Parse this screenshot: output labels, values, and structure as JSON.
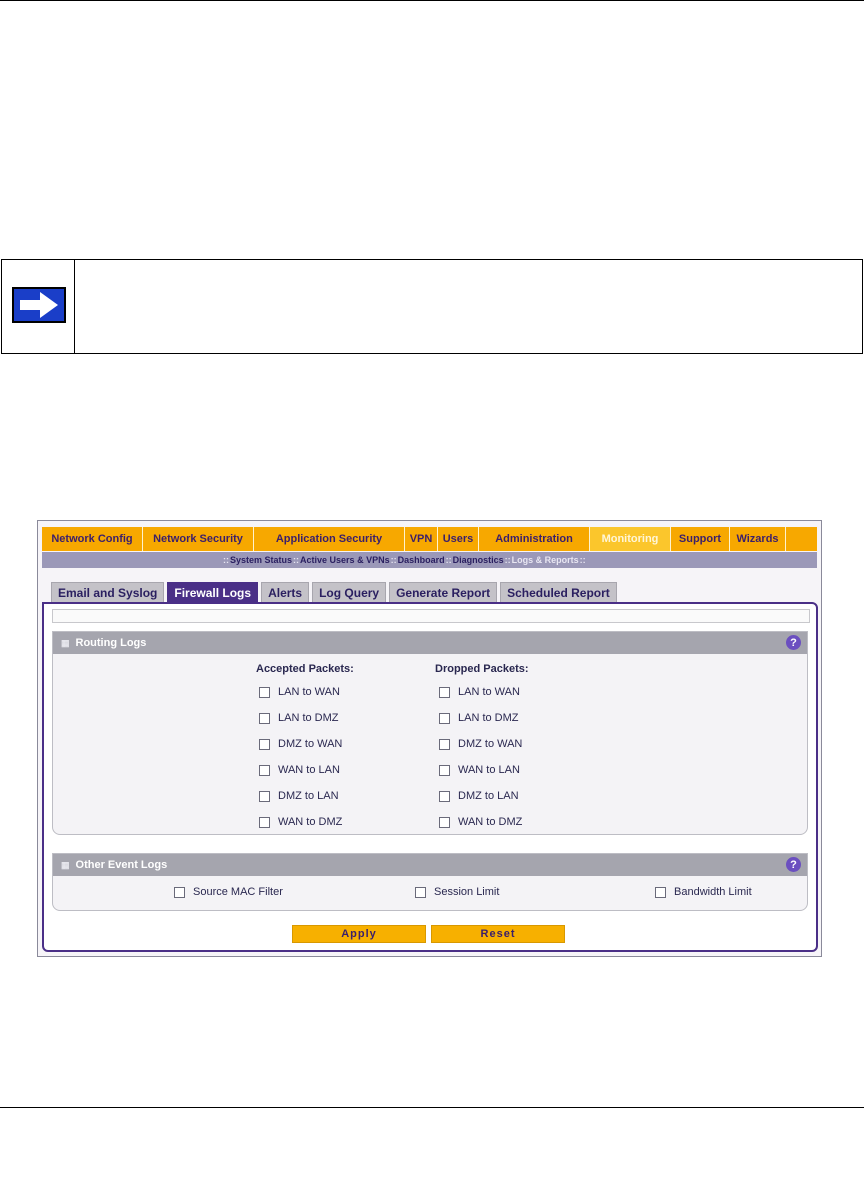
{
  "nav": [
    {
      "label": "Network Config",
      "width": 100
    },
    {
      "label": "Network Security",
      "width": 110
    },
    {
      "label": "Application Security",
      "width": 150
    },
    {
      "label": "VPN",
      "width": 32
    },
    {
      "label": "Users",
      "width": 40
    },
    {
      "label": "Administration",
      "width": 110
    },
    {
      "label": "Monitoring",
      "width": 80
    },
    {
      "label": "Support",
      "width": 58
    },
    {
      "label": "Wizards",
      "width": 55
    }
  ],
  "nav_active": "Monitoring",
  "subnav": [
    {
      "label": "System Status"
    },
    {
      "label": "Active Users & VPNs"
    },
    {
      "label": "Dashboard"
    },
    {
      "label": "Diagnostics"
    },
    {
      "label": "Logs & Reports"
    }
  ],
  "tabs": [
    "Email and Syslog",
    "Firewall Logs",
    "Alerts",
    "Log Query",
    "Generate Report",
    "Scheduled Report"
  ],
  "tab_active": "Firewall Logs",
  "routing": {
    "title": "Routing Logs",
    "accepted_label": "Accepted Packets:",
    "dropped_label": "Dropped Packets:",
    "options": [
      "LAN to WAN",
      "LAN to DMZ",
      "DMZ to WAN",
      "WAN to LAN",
      "DMZ to LAN",
      "WAN to DMZ"
    ]
  },
  "other": {
    "title": "Other Event Logs",
    "options": [
      "Source MAC Filter",
      "Session Limit",
      "Bandwidth Limit"
    ]
  },
  "buttons": {
    "apply": "Apply",
    "reset": "Reset"
  },
  "help_glyph": "?",
  "colors": {
    "nav_orange": "#f7a800",
    "active_tab": "#4a2f87",
    "note_arrow": "#1a3ec8"
  }
}
